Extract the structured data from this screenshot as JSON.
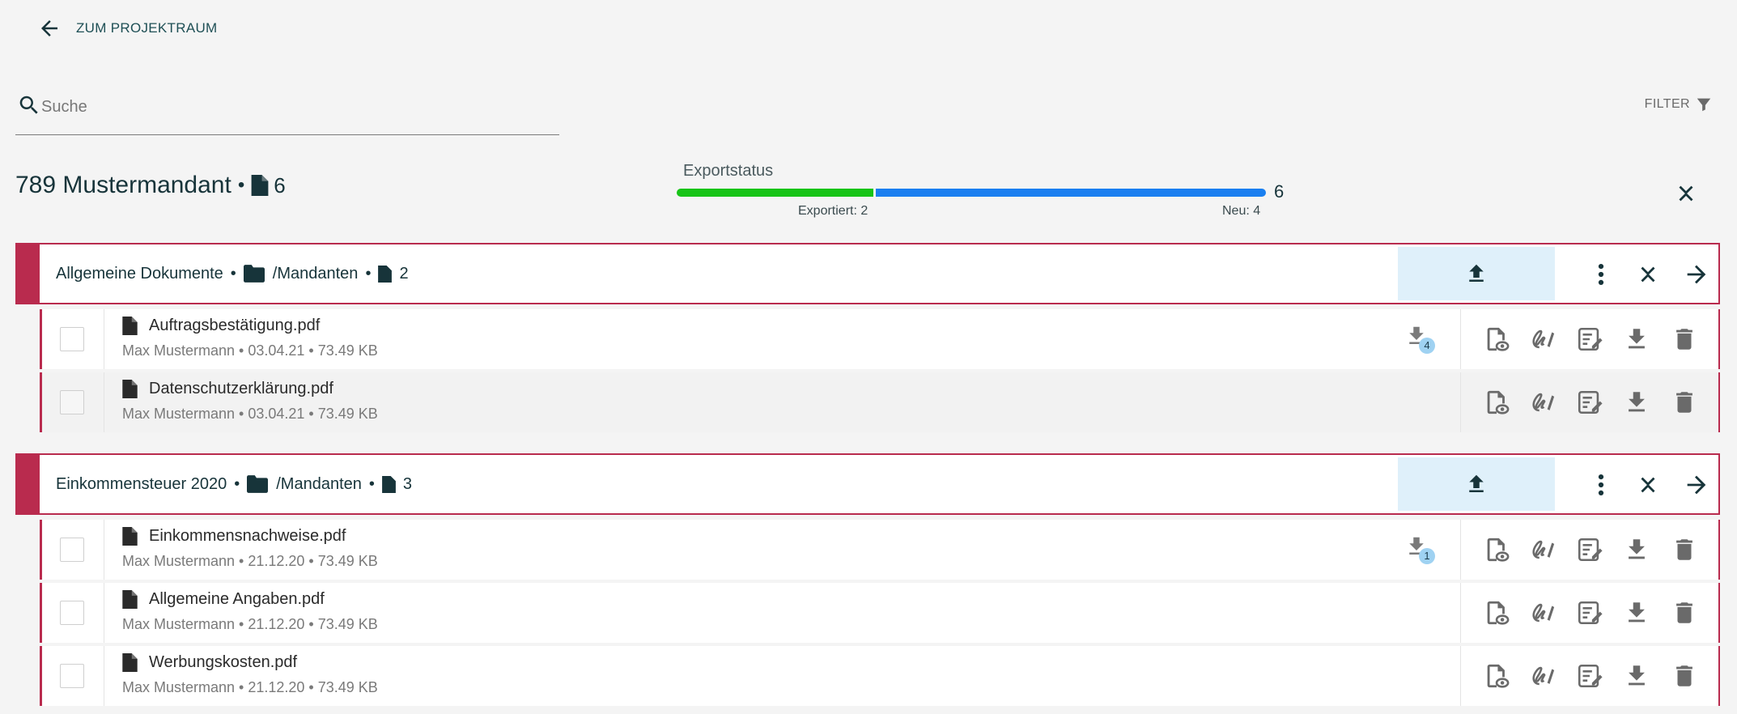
{
  "nav": {
    "back_label": "ZUM PROJEKTRAUM"
  },
  "search": {
    "placeholder": "Suche",
    "value": ""
  },
  "filter": {
    "label": "FILTER"
  },
  "mandant": {
    "title": "789 Mustermandant",
    "separator": "•",
    "doc_count": "6"
  },
  "export_status": {
    "title": "Exportstatus",
    "exported": 2,
    "new": 4,
    "total": "6",
    "exported_label": "Exportiert: 2",
    "new_label": "Neu: 4",
    "colors": {
      "exported": "#17c417",
      "new": "#1a7ff0"
    }
  },
  "colors": {
    "accent": "#b92b4e",
    "upload_bg": "#dff0fa",
    "text": "#17343a"
  },
  "groups": [
    {
      "title": "Allgemeine Dokumente",
      "dot": "•",
      "folder": "/Mandanten",
      "count": "2",
      "files": [
        {
          "name": "Auftragsbestätigung.pdf",
          "meta": "Max Mustermann • 03.04.21 • 73.49 KB",
          "downloads": "4"
        },
        {
          "name": "Datenschutzerklärung.pdf",
          "meta": "Max Mustermann • 03.04.21 • 73.49 KB"
        }
      ]
    },
    {
      "title": "Einkommensteuer 2020",
      "dot": "•",
      "folder": "/Mandanten",
      "count": "3",
      "files": [
        {
          "name": "Einkommensnachweise.pdf",
          "meta": "Max Mustermann • 21.12.20 • 73.49 KB",
          "downloads": "1"
        },
        {
          "name": "Allgemeine Angaben.pdf",
          "meta": "Max Mustermann • 21.12.20 • 73.49 KB"
        },
        {
          "name": "Werbungskosten.pdf",
          "meta": "Max Mustermann • 21.12.20 • 73.49 KB"
        }
      ]
    }
  ]
}
